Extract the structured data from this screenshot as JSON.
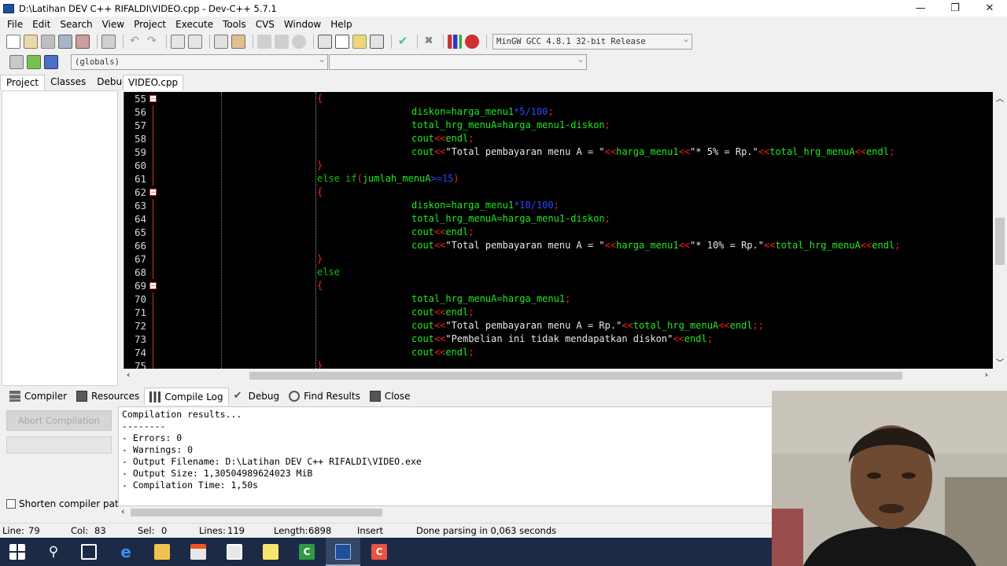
{
  "window": {
    "title": "D:\\Latihan DEV C++ RIFALDI\\VIDEO.cpp - Dev-C++ 5.7.1",
    "controls": [
      "—",
      "❐",
      "✕"
    ]
  },
  "menu": [
    "File",
    "Edit",
    "Search",
    "View",
    "Project",
    "Execute",
    "Tools",
    "CVS",
    "Window",
    "Help"
  ],
  "toolbar": {
    "compiler_select": "MinGW GCC 4.8.1 32-bit Release",
    "globals_select": "(globals)",
    "functions_select": ""
  },
  "left_tabs": [
    "Project",
    "Classes",
    "Debug"
  ],
  "file_tab": "VIDEO.cpp",
  "editor": {
    "line_numbers": [
      "55",
      "56",
      "57",
      "58",
      "59",
      "60",
      "61",
      "62",
      "63",
      "64",
      "65",
      "66",
      "67",
      "68",
      "69",
      "70",
      "71",
      "72",
      "73",
      "74",
      "75"
    ],
    "lines": [
      [
        {
          "t": "{",
          "c": "red",
          "i": 2
        }
      ],
      [
        {
          "t": "diskon=harga_menu1",
          "c": "grn",
          "i": 4
        },
        {
          "t": "*5/100",
          "c": "blu"
        },
        {
          "t": ";",
          "c": "red"
        }
      ],
      [
        {
          "t": "total_hrg_menuA=harga_menu1-diskon",
          "c": "grn",
          "i": 4
        },
        {
          "t": ";",
          "c": "red"
        }
      ],
      [
        {
          "t": "cout",
          "c": "grn",
          "i": 4
        },
        {
          "t": "<<",
          "c": "red"
        },
        {
          "t": "endl",
          "c": "grn"
        },
        {
          "t": ";",
          "c": "red"
        }
      ],
      [
        {
          "t": "cout",
          "c": "grn",
          "i": 4
        },
        {
          "t": "<<",
          "c": "red"
        },
        {
          "t": "\"Total pembayaran menu A = \"",
          "c": "wht"
        },
        {
          "t": "<<",
          "c": "red"
        },
        {
          "t": "harga_menu1",
          "c": "grn"
        },
        {
          "t": "<<",
          "c": "red"
        },
        {
          "t": "\"* 5% = Rp.\"",
          "c": "wht"
        },
        {
          "t": "<<",
          "c": "red"
        },
        {
          "t": "total_hrg_menuA",
          "c": "grn"
        },
        {
          "t": "<<",
          "c": "red"
        },
        {
          "t": "endl",
          "c": "grn"
        },
        {
          "t": ";",
          "c": "red"
        }
      ],
      [
        {
          "t": "}",
          "c": "red",
          "i": 2
        }
      ],
      [
        {
          "t": "else if",
          "c": "dg",
          "i": 2
        },
        {
          "t": "(",
          "c": "red"
        },
        {
          "t": "jumlah_menuA",
          "c": "grn"
        },
        {
          "t": ">=15",
          "c": "blu"
        },
        {
          "t": ")",
          "c": "red"
        }
      ],
      [
        {
          "t": "{",
          "c": "red",
          "i": 2
        }
      ],
      [
        {
          "t": "diskon=harga_menu1",
          "c": "grn",
          "i": 4
        },
        {
          "t": "*10/100",
          "c": "blu"
        },
        {
          "t": ";",
          "c": "red"
        }
      ],
      [
        {
          "t": "total_hrg_menuA=harga_menu1-diskon",
          "c": "grn",
          "i": 4
        },
        {
          "t": ";",
          "c": "red"
        }
      ],
      [
        {
          "t": "cout",
          "c": "grn",
          "i": 4
        },
        {
          "t": "<<",
          "c": "red"
        },
        {
          "t": "endl",
          "c": "grn"
        },
        {
          "t": ";",
          "c": "red"
        }
      ],
      [
        {
          "t": "cout",
          "c": "grn",
          "i": 4
        },
        {
          "t": "<<",
          "c": "red"
        },
        {
          "t": "\"Total pembayaran menu A = \"",
          "c": "wht"
        },
        {
          "t": "<<",
          "c": "red"
        },
        {
          "t": "harga_menu1",
          "c": "grn"
        },
        {
          "t": "<<",
          "c": "red"
        },
        {
          "t": "\"* 10% = Rp.\"",
          "c": "wht"
        },
        {
          "t": "<<",
          "c": "red"
        },
        {
          "t": "total_hrg_menuA",
          "c": "grn"
        },
        {
          "t": "<<",
          "c": "red"
        },
        {
          "t": "endl",
          "c": "grn"
        },
        {
          "t": ";",
          "c": "red"
        }
      ],
      [
        {
          "t": "}",
          "c": "red",
          "i": 2
        }
      ],
      [
        {
          "t": "else",
          "c": "dg",
          "i": 2
        }
      ],
      [
        {
          "t": "{",
          "c": "red",
          "i": 2
        }
      ],
      [
        {
          "t": "total_hrg_menuA=harga_menu1",
          "c": "grn",
          "i": 4
        },
        {
          "t": ";",
          "c": "red"
        }
      ],
      [
        {
          "t": "cout",
          "c": "grn",
          "i": 4
        },
        {
          "t": "<<",
          "c": "red"
        },
        {
          "t": "endl",
          "c": "grn"
        },
        {
          "t": ";",
          "c": "red"
        }
      ],
      [
        {
          "t": "cout",
          "c": "grn",
          "i": 4
        },
        {
          "t": "<<",
          "c": "red"
        },
        {
          "t": "\"Total pembayaran menu A = Rp.\"",
          "c": "wht"
        },
        {
          "t": "<<",
          "c": "red"
        },
        {
          "t": "total_hrg_menuA",
          "c": "grn"
        },
        {
          "t": "<<",
          "c": "red"
        },
        {
          "t": "endl",
          "c": "grn"
        },
        {
          "t": ";;",
          "c": "red"
        }
      ],
      [
        {
          "t": "cout",
          "c": "grn",
          "i": 4
        },
        {
          "t": "<<",
          "c": "red"
        },
        {
          "t": "\"Pembelian ini tidak mendapatkan diskon\"",
          "c": "wht"
        },
        {
          "t": "<<",
          "c": "red"
        },
        {
          "t": "endl",
          "c": "grn"
        },
        {
          "t": ";",
          "c": "red"
        }
      ],
      [
        {
          "t": "cout",
          "c": "grn",
          "i": 4
        },
        {
          "t": "<<",
          "c": "red"
        },
        {
          "t": "endl",
          "c": "grn"
        },
        {
          "t": ";",
          "c": "red"
        }
      ],
      [
        {
          "t": "}",
          "c": "red",
          "i": 2
        }
      ]
    ]
  },
  "bottom_tabs": [
    "Compiler",
    "Resources",
    "Compile Log",
    "Debug",
    "Find Results",
    "Close"
  ],
  "abort_button": "Abort Compilation",
  "shorten_paths_label": "Shorten compiler paths",
  "log": [
    "Compilation results...",
    "--------",
    "- Errors: 0",
    "- Warnings: 0",
    "- Output Filename: D:\\Latihan DEV C++ RIFALDI\\VIDEO.exe",
    "- Output Size: 1,30504989624023 MiB",
    "- Compilation Time: 1,50s"
  ],
  "status": {
    "line_label": "Line:",
    "line": "79",
    "col_label": "Col:",
    "col": "83",
    "sel_label": "Sel:",
    "sel": "0",
    "lines_label": "Lines:",
    "lines": "119",
    "length_label": "Length:",
    "length": "6898",
    "mode": "Insert",
    "message": "Done parsing in 0,063 seconds"
  },
  "taskbar_icons": [
    "windows-start-icon",
    "search-icon",
    "task-view-icon",
    "edge-icon",
    "file-explorer-icon",
    "store-icon",
    "mail-icon",
    "sticky-notes-icon",
    "camtasia-icon",
    "devcpp-icon",
    "recorder-icon"
  ],
  "colors": {
    "editor_bg": "#000000",
    "keyword": "#11c011",
    "identifier": "#22e822",
    "operator": "#ff2020",
    "number": "#2e4aff",
    "string": "#e8e8e8",
    "taskbar": "#1c2a45"
  }
}
